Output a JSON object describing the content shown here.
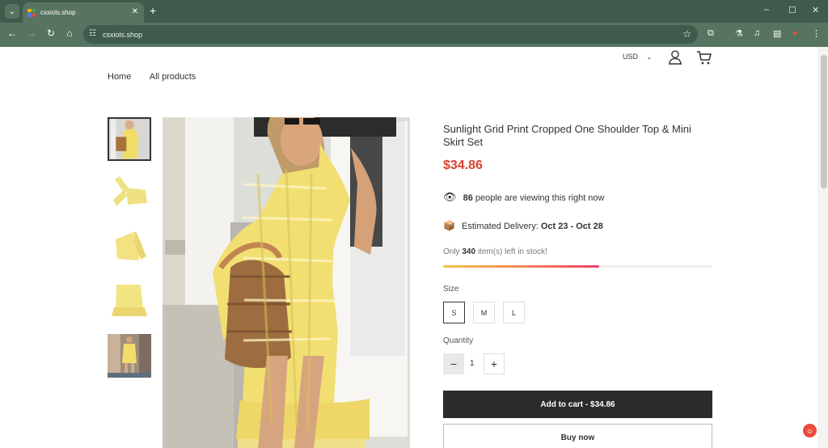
{
  "browser": {
    "tab_title": "csxiols.shop",
    "new_tab": "+",
    "url": "csxiols.shop",
    "window_controls": [
      "–",
      "☐",
      "✕"
    ],
    "favicon_colors": [
      "#f6b400",
      "#4ca64c",
      "#4f7fe0",
      "#df4b3f"
    ]
  },
  "store": {
    "currency": "USD",
    "nav": [
      "Home",
      "All products"
    ]
  },
  "product": {
    "title": "Sunlight Grid Print Cropped One Shoulder Top & Mini Skirt Set",
    "price": "$34.86",
    "viewing": {
      "count": "86",
      "text": "people are viewing this right now"
    },
    "delivery": {
      "label": "Estimated Delivery:",
      "dates": "Oct 23 - Oct 28"
    },
    "stock": {
      "prefix": "Only",
      "count": "340",
      "suffix": "item(s) left in stock!",
      "level": 0.58
    },
    "size_label": "Size",
    "sizes": [
      "S",
      "M",
      "L"
    ],
    "selected_size": "S",
    "quantity_label": "Quantity",
    "quantity": "1",
    "add_to_cart": "Add to cart - $34.86",
    "buy_now": "Buy now"
  },
  "icons": {
    "account": "user-icon",
    "cart": "cart-icon",
    "viewing": "eye-icon",
    "delivery": "package-icon"
  },
  "colors": {
    "browser_green": "#3e5b4d",
    "price_red": "#d7432d",
    "button_dark": "#2b2b2b",
    "dress_yellow": "#f2df72"
  }
}
